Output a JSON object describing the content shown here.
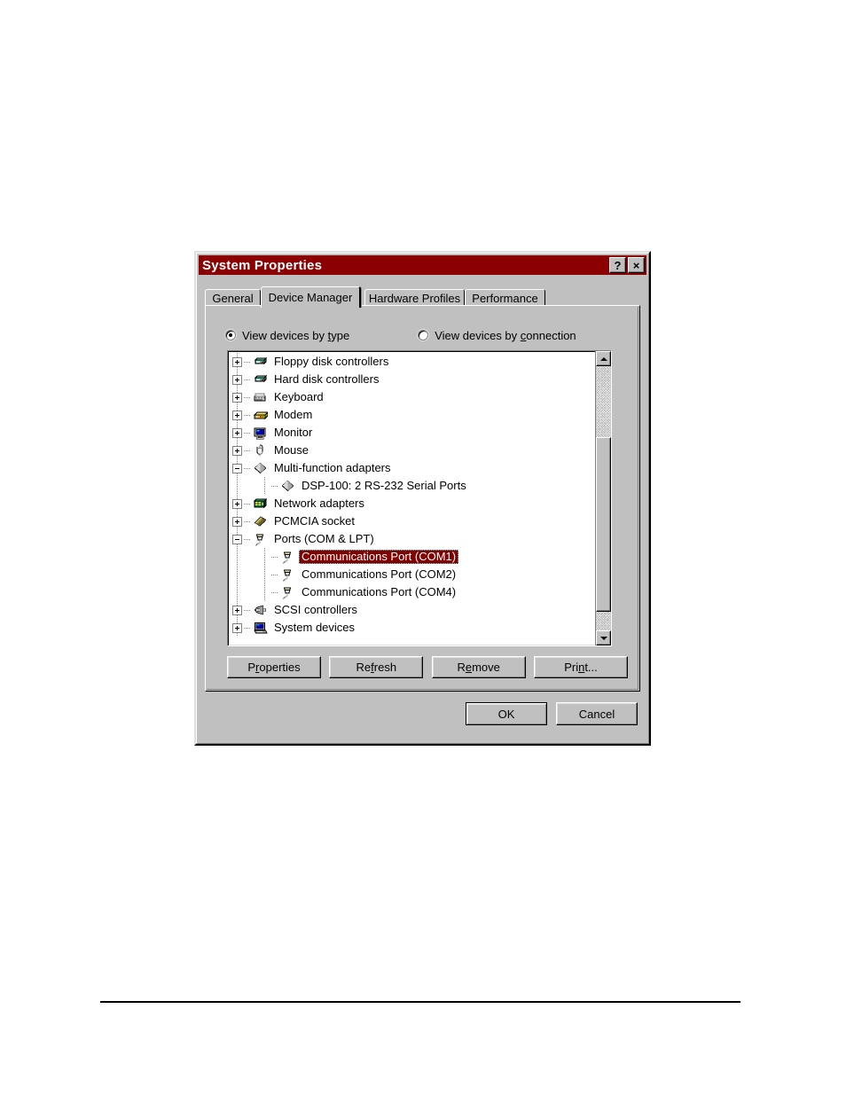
{
  "window": {
    "title": "System Properties",
    "help_button": "?",
    "close_button": "×"
  },
  "tabs": [
    {
      "label": "General",
      "active": false
    },
    {
      "label": "Device Manager",
      "active": true
    },
    {
      "label": "Hardware Profiles",
      "active": false
    },
    {
      "label": "Performance",
      "active": false
    }
  ],
  "view_options": {
    "by_type": {
      "label_before": "View devices by ",
      "accel": "t",
      "label_after": "ype",
      "selected": true
    },
    "by_connection": {
      "label_before": "View devices by ",
      "accel": "c",
      "label_after": "onnection",
      "selected": false
    }
  },
  "device_tree": {
    "selected_item": "Communications Port (COM1)",
    "selection_color": "#800000",
    "rows": [
      {
        "label": "Floppy disk controllers",
        "depth": 0,
        "expander": "plus",
        "icon": "floppy-disk-controller-icon",
        "selected": false
      },
      {
        "label": "Hard disk controllers",
        "depth": 0,
        "expander": "plus",
        "icon": "hard-disk-controller-icon",
        "selected": false
      },
      {
        "label": "Keyboard",
        "depth": 0,
        "expander": "plus",
        "icon": "keyboard-icon",
        "selected": false
      },
      {
        "label": "Modem",
        "depth": 0,
        "expander": "plus",
        "icon": "modem-icon",
        "selected": false
      },
      {
        "label": "Monitor",
        "depth": 0,
        "expander": "plus",
        "icon": "monitor-icon",
        "selected": false
      },
      {
        "label": "Mouse",
        "depth": 0,
        "expander": "plus",
        "icon": "mouse-icon",
        "selected": false
      },
      {
        "label": "Multi-function adapters",
        "depth": 0,
        "expander": "minus",
        "icon": "multifunction-adapter-icon",
        "selected": false
      },
      {
        "label": "DSP-100:  2 RS-232 Serial Ports",
        "depth": 1,
        "expander": "none",
        "icon": "multifunction-adapter-icon",
        "selected": false
      },
      {
        "label": "Network adapters",
        "depth": 0,
        "expander": "plus",
        "icon": "network-adapter-icon",
        "selected": false
      },
      {
        "label": "PCMCIA socket",
        "depth": 0,
        "expander": "plus",
        "icon": "pcmcia-socket-icon",
        "selected": false
      },
      {
        "label": "Ports (COM & LPT)",
        "depth": 0,
        "expander": "minus",
        "icon": "port-icon",
        "selected": false
      },
      {
        "label": "Communications Port (COM1)",
        "depth": 1,
        "expander": "none",
        "icon": "port-icon",
        "selected": true
      },
      {
        "label": "Communications Port (COM2)",
        "depth": 1,
        "expander": "none",
        "icon": "port-icon",
        "selected": false
      },
      {
        "label": "Communications Port (COM4)",
        "depth": 1,
        "expander": "none",
        "icon": "port-icon",
        "selected": false
      },
      {
        "label": "SCSI controllers",
        "depth": 0,
        "expander": "plus",
        "icon": "scsi-controller-icon",
        "selected": false
      },
      {
        "label": "System devices",
        "depth": 0,
        "expander": "plus",
        "icon": "system-device-icon",
        "selected": false
      }
    ]
  },
  "scrollbar": {
    "up_arrow": "scroll-up-arrow-icon",
    "down_arrow": "scroll-down-arrow-icon",
    "thumb_top_pct": 27,
    "thumb_height_pct": 66
  },
  "action_buttons": [
    {
      "name": "properties",
      "before": "P",
      "accel": "r",
      "after": "operties"
    },
    {
      "name": "refresh",
      "before": "Re",
      "accel": "f",
      "after": "resh"
    },
    {
      "name": "remove",
      "before": "R",
      "accel": "e",
      "after": "move"
    },
    {
      "name": "print",
      "before": "Pri",
      "accel": "n",
      "after": "t..."
    }
  ],
  "dialog_buttons": {
    "ok": "OK",
    "cancel": "Cancel"
  }
}
